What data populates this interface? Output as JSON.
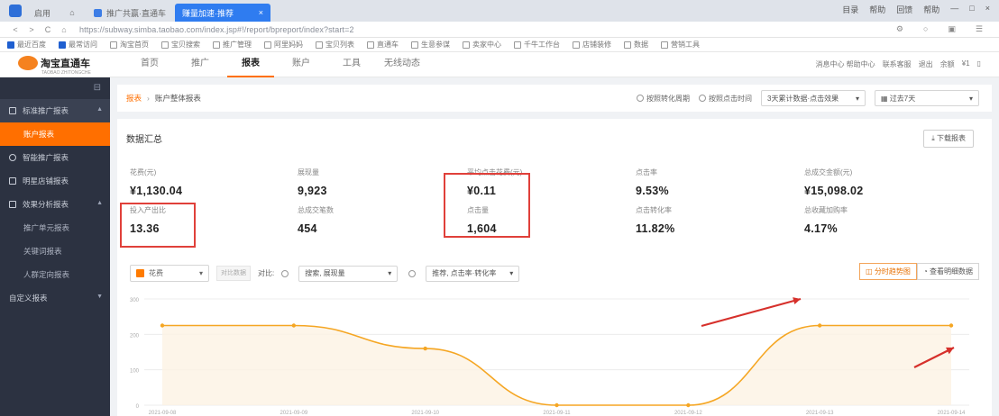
{
  "browser": {
    "tabs": [
      {
        "label": "启用"
      },
      {
        "label": "推广共赢·直通车"
      },
      {
        "label": "赚量加速·推荐"
      }
    ],
    "tab_close": "×",
    "window_controls": [
      "目录",
      "帮助",
      "回馈",
      "帮助",
      "—",
      "□",
      "×"
    ],
    "url": "https://subway.simba.taobao.com/index.jsp#!/report/bpreport/index?start=2",
    "nav": [
      "<",
      ">",
      "C",
      "⌂"
    ],
    "bookmarks": [
      "最近百度",
      "最常访问",
      "淘宝首页",
      "宝贝搜索",
      "推广管理",
      "阿里妈妈",
      "宝贝列表",
      "直通车",
      "生意参谋",
      "卖家中心",
      "千牛工作台",
      "店铺装修",
      "数据",
      "营销工具"
    ]
  },
  "header": {
    "logo_text": "淘宝直通车",
    "logo_sub": "TAOBAO ZHITONGCHE",
    "nav": [
      {
        "label": "首页",
        "active": false
      },
      {
        "label": "推广",
        "active": false
      },
      {
        "label": "报表",
        "active": true
      },
      {
        "label": "账户",
        "active": false
      },
      {
        "label": "工具",
        "active": false
      },
      {
        "label": "无线动态",
        "active": false
      }
    ],
    "right": [
      "消息中心 帮助中心",
      "联系客服",
      "退出",
      "余额",
      "¥1"
    ]
  },
  "sidebar": {
    "collapse_icon": "⊟",
    "groups": [
      {
        "label": "标准推广报表",
        "open": true,
        "subs": [
          {
            "label": "账户报表",
            "active": true
          }
        ]
      },
      {
        "label": "智能推广报表",
        "open": false,
        "subs": []
      },
      {
        "label": "明星店铺报表",
        "open": false,
        "subs": []
      },
      {
        "label": "效果分析报表",
        "open": true,
        "subs": [
          {
            "label": "推广单元报表"
          },
          {
            "label": "关键词报表"
          },
          {
            "label": "人群定向报表"
          }
        ]
      },
      {
        "label": "自定义报表",
        "open": false,
        "subs": []
      }
    ]
  },
  "breadcrumb": {
    "home": "报表",
    "sep": "›",
    "current": "账户整体报表"
  },
  "filters": {
    "opt1": "按照转化周期",
    "opt2": "按照点击时间",
    "select1": "3天累计数据·点击效果",
    "select2": "过去7天"
  },
  "card": {
    "title": "数据汇总",
    "title_button": "下载报表",
    "metrics": [
      {
        "label": "花费(元)",
        "value": "¥1,130.04"
      },
      {
        "label": "展现量",
        "value": "9,923"
      },
      {
        "label": "平均点击花费(元)",
        "value": "¥0.11"
      },
      {
        "label": "点击率",
        "value": "9.53%"
      },
      {
        "label": "总成交金额(元)",
        "value": "¥15,098.02"
      },
      {
        "label": "投入产出比",
        "value": "13.36"
      },
      {
        "label": "总成交笔数",
        "value": "454"
      },
      {
        "label": "点击量",
        "value": "1,604"
      },
      {
        "label": "点击转化率",
        "value": "11.82%"
      },
      {
        "label": "总收藏加购率",
        "value": "4.17%"
      }
    ]
  },
  "chart_toolbar": {
    "metric_select": "花费",
    "compare_label": "对比数据",
    "compare_prefix": "对比:",
    "select_a": "搜索, 展现量",
    "select_b": "推荐, 点击率·转化率",
    "btn_trend": "分时趋势图",
    "btn_detail": "查看明细数据"
  },
  "chart_data": {
    "type": "line",
    "x": [
      "2021-09-08",
      "2021-09-09",
      "2021-09-10",
      "2021-09-11",
      "2021-09-12",
      "2021-09-13",
      "2021-09-14"
    ],
    "series": [
      {
        "name": "花费",
        "values": [
          225,
          225,
          160,
          0,
          0,
          225,
          225
        ]
      }
    ],
    "yticks": [
      0,
      100,
      200,
      300
    ],
    "ylim": [
      0,
      300
    ],
    "grid": true,
    "color": "#f5a623"
  },
  "colors": {
    "accent": "#ff6f00",
    "sidebar": "#2c3241",
    "highlight": "#e0403a",
    "arrow": "#d6302b"
  }
}
